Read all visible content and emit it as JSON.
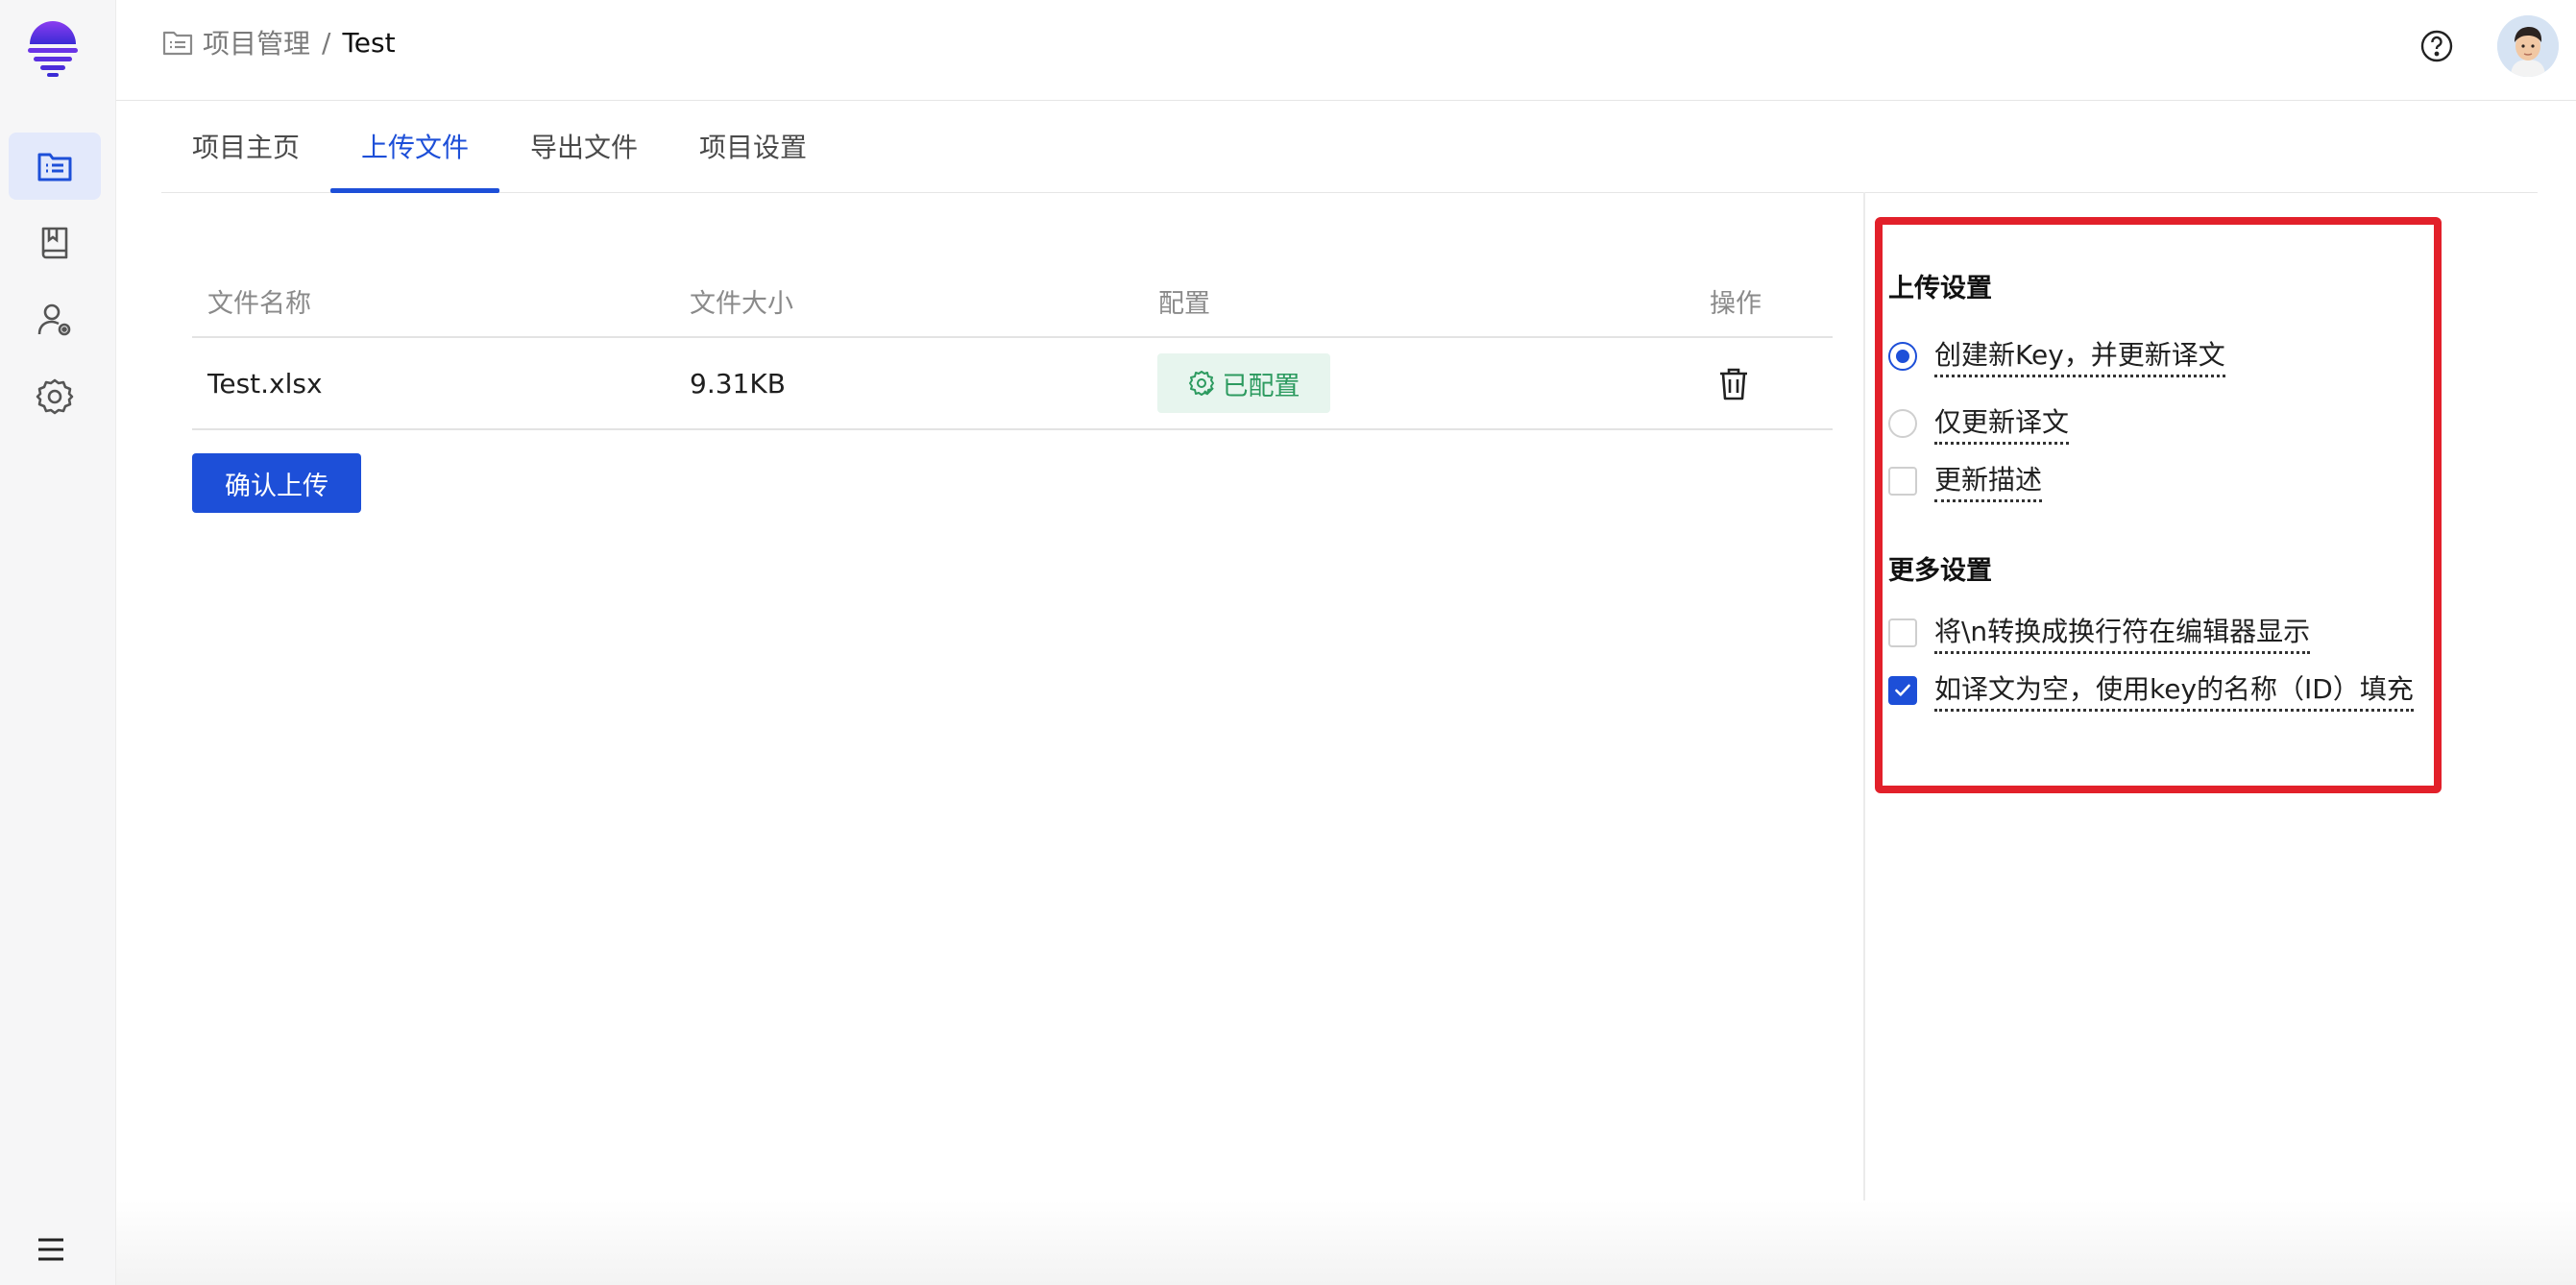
{
  "breadcrumb": {
    "parent": "项目管理",
    "separator": "/",
    "current": "Test"
  },
  "sidebar": {
    "items": [
      {
        "name": "projects",
        "icon": "file-list-icon",
        "active": true
      },
      {
        "name": "docs",
        "icon": "book-icon",
        "active": false
      },
      {
        "name": "members",
        "icon": "user-settings-icon",
        "active": false
      },
      {
        "name": "settings",
        "icon": "gear-icon",
        "active": false
      }
    ]
  },
  "tabs": [
    {
      "label": "项目主页",
      "active": false
    },
    {
      "label": "上传文件",
      "active": true
    },
    {
      "label": "导出文件",
      "active": false
    },
    {
      "label": "项目设置",
      "active": false
    }
  ],
  "table": {
    "headers": [
      "文件名称",
      "文件大小",
      "配置",
      "操作"
    ],
    "rows": [
      {
        "file_name": "Test.xlsx",
        "file_size": "9.31KB",
        "config_status": "已配置"
      }
    ]
  },
  "confirm_button": "确认上传",
  "upload_settings": {
    "title": "上传设置",
    "options": [
      {
        "label": "创建新Key，并更新译文",
        "type": "radio",
        "checked": true
      },
      {
        "label": "仅更新译文",
        "type": "radio",
        "checked": false
      },
      {
        "label": "更新描述",
        "type": "checkbox",
        "checked": false
      }
    ]
  },
  "more_settings": {
    "title": "更多设置",
    "options": [
      {
        "label": "将\\n转换成换行符在编辑器显示",
        "type": "checkbox",
        "checked": false
      },
      {
        "label": "如译文为空，使用key的名称（ID）填充",
        "type": "checkbox",
        "checked": true
      }
    ]
  },
  "colors": {
    "accent": "#1d4fd8",
    "success": "#2c9a5f",
    "success_bg": "#e7f5ee",
    "highlight_border": "#e2202a"
  }
}
